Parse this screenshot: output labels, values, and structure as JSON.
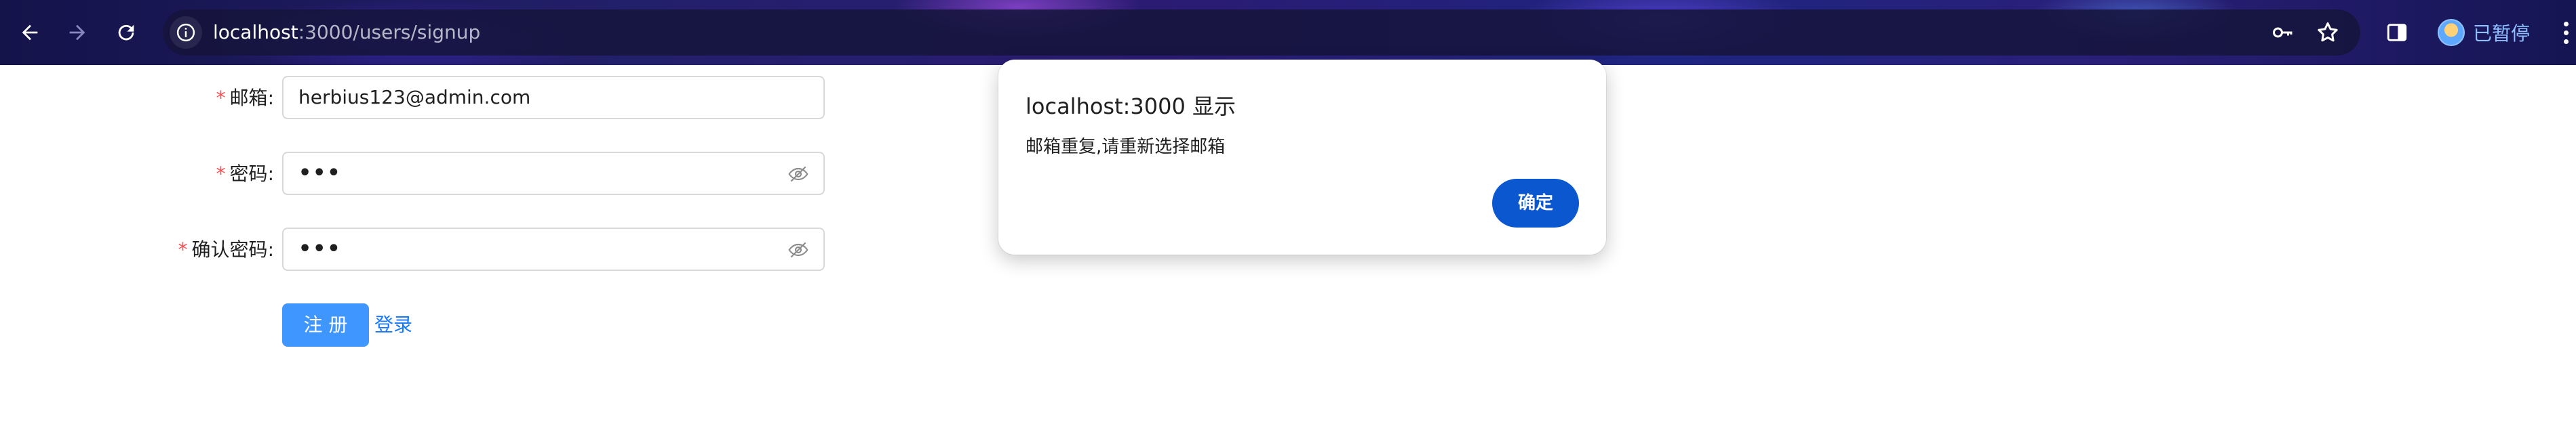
{
  "browser": {
    "url_host": "localhost",
    "url_rest": ":3000/users/signup",
    "profile_label": "已暂停",
    "icons": [
      "back-arrow-icon",
      "forward-arrow-icon",
      "reload-icon",
      "info-icon",
      "key-icon",
      "star-icon",
      "side-panel-icon",
      "avatar",
      "more-menu-icon"
    ]
  },
  "form": {
    "required_mark": "*",
    "email": {
      "label": "邮箱",
      "colon": ":",
      "value": "herbius123@admin.com"
    },
    "password": {
      "label": "密码",
      "colon": ":",
      "value": "•••"
    },
    "confirm_password": {
      "label": "确认密码",
      "colon": ":",
      "value": "•••"
    },
    "signup_button": "注 册",
    "login_link": "登录"
  },
  "dialog": {
    "title": "localhost:3000 显示",
    "message": "邮箱重复,请重新选择邮箱",
    "ok_button": "确定"
  },
  "colors": {
    "required": "#ff4d4f",
    "primary_button": "#4096ff",
    "link": "#1677ff",
    "dialog_button": "#0b57d0"
  }
}
